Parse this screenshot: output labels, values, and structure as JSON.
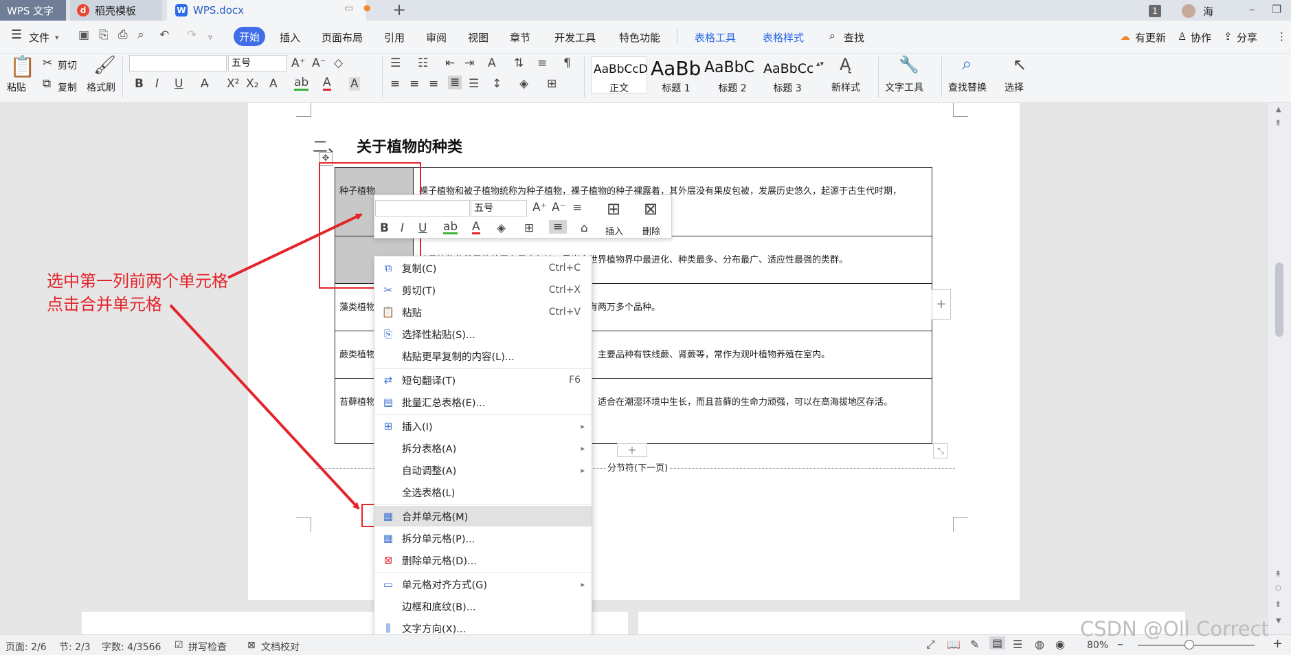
{
  "tabs": {
    "app": "WPS 文字",
    "template": "稻壳模板",
    "doc": "WPS.docx",
    "add": "+"
  },
  "user": {
    "badge": "1",
    "name": "海"
  },
  "menubar": {
    "file": "文件",
    "start": "开始",
    "items": [
      "插入",
      "页面布局",
      "引用",
      "审阅",
      "视图",
      "章节",
      "开发工具",
      "特色功能"
    ],
    "table_tools": "表格工具",
    "table_style": "表格样式",
    "search": "查找",
    "update": "有更新",
    "collab": "协作",
    "share": "分享"
  },
  "ribbon": {
    "paste": "粘贴",
    "cut": "剪切",
    "copy": "复制",
    "format_painter": "格式刷",
    "font_name": "",
    "font_size": "五号",
    "styles": [
      {
        "preview": "AaBbCcD",
        "name": "正文"
      },
      {
        "preview": "AaBb",
        "name": "标题 1"
      },
      {
        "preview": "AaBbC",
        "name": "标题 2"
      },
      {
        "preview": "AaBbCc",
        "name": "标题 3"
      }
    ],
    "new_style": "新样式",
    "text_tools": "文字工具",
    "find_replace": "查找替换",
    "select": "选择"
  },
  "document": {
    "heading_num": "二、",
    "heading": "关于植物的种类",
    "table_rows": [
      {
        "c0": "种子植物",
        "c1": "裸子植物和被子植物统称为种子植物，裸子植物的种子裸露着，其外层没有果皮包被，发展历史悠久，起源于古生代时期，"
      },
      {
        "c0": "",
        "c1": "被子植物的种子的外层有果皮包被，是当今世界植物界中最进化、种类最多、分布最广、适应性最强的类群。"
      },
      {
        "c0": "藻类植物",
        "c1": "藻类植物种类繁多，数量庞大，全球范围内有两万多个品种。"
      },
      {
        "c0": "蕨类植物",
        "c1": "蕨类植物从古生代泥盆纪时期开始发展扩大，主要品种有铁线蕨、肾蕨等，常作为观叶植物养殖在室内。"
      },
      {
        "c0": "苔藓植物",
        "c1": "苔藓植物全球有两万多个品种，其株形矮小，适合在潮湿环境中生长，而且苔藓的生命力顽强，可以在高海拔地区存活。"
      }
    ],
    "section_break": "分节符(下一页)"
  },
  "annotation": {
    "line1": "选中第一列前两个单元格",
    "line2": "点击合并单元格"
  },
  "mini_toolbar": {
    "font_name": "",
    "font_size": "五号",
    "insert": "插入",
    "delete": "删除"
  },
  "context_menu": [
    {
      "label": "复制(C)",
      "shortcut": "Ctrl+C",
      "icon": "copy-icon"
    },
    {
      "label": "剪切(T)",
      "shortcut": "Ctrl+X",
      "icon": "scissors-icon"
    },
    {
      "label": "粘贴",
      "shortcut": "Ctrl+V",
      "icon": "paste-icon"
    },
    {
      "label": "选择性粘贴(S)...",
      "shortcut": "",
      "icon": "paste-special-icon"
    },
    {
      "label": "粘贴更早复制的内容(L)...",
      "shortcut": "",
      "icon": ""
    },
    {
      "label": "短句翻译(T)",
      "shortcut": "F6",
      "icon": "translate-icon"
    },
    {
      "label": "批量汇总表格(E)...",
      "shortcut": "",
      "icon": "table-summary-icon"
    },
    {
      "label": "插入(I)",
      "shortcut": "",
      "icon": "table-insert-icon"
    },
    {
      "label": "拆分表格(A)",
      "shortcut": "",
      "icon": ""
    },
    {
      "label": "自动调整(A)",
      "shortcut": "",
      "icon": ""
    },
    {
      "label": "全选表格(L)",
      "shortcut": "",
      "icon": ""
    },
    {
      "label": "合并单元格(M)",
      "shortcut": "",
      "icon": "merge-cells-icon"
    },
    {
      "label": "拆分单元格(P)...",
      "shortcut": "",
      "icon": "split-cells-icon"
    },
    {
      "label": "删除单元格(D)...",
      "shortcut": "",
      "icon": "delete-cells-icon"
    },
    {
      "label": "单元格对齐方式(G)",
      "shortcut": "",
      "icon": "cell-align-icon"
    },
    {
      "label": "边框和底纹(B)...",
      "shortcut": "",
      "icon": ""
    },
    {
      "label": "文字方向(X)...",
      "shortcut": "",
      "icon": "text-direction-icon"
    }
  ],
  "statusbar": {
    "page": "页面: 2/6",
    "section": "节: 2/3",
    "words": "字数: 4/3566",
    "spell": "拼写检查",
    "proof": "文档校对",
    "zoom": "80%"
  },
  "watermark": "CSDN @Oll Correct"
}
